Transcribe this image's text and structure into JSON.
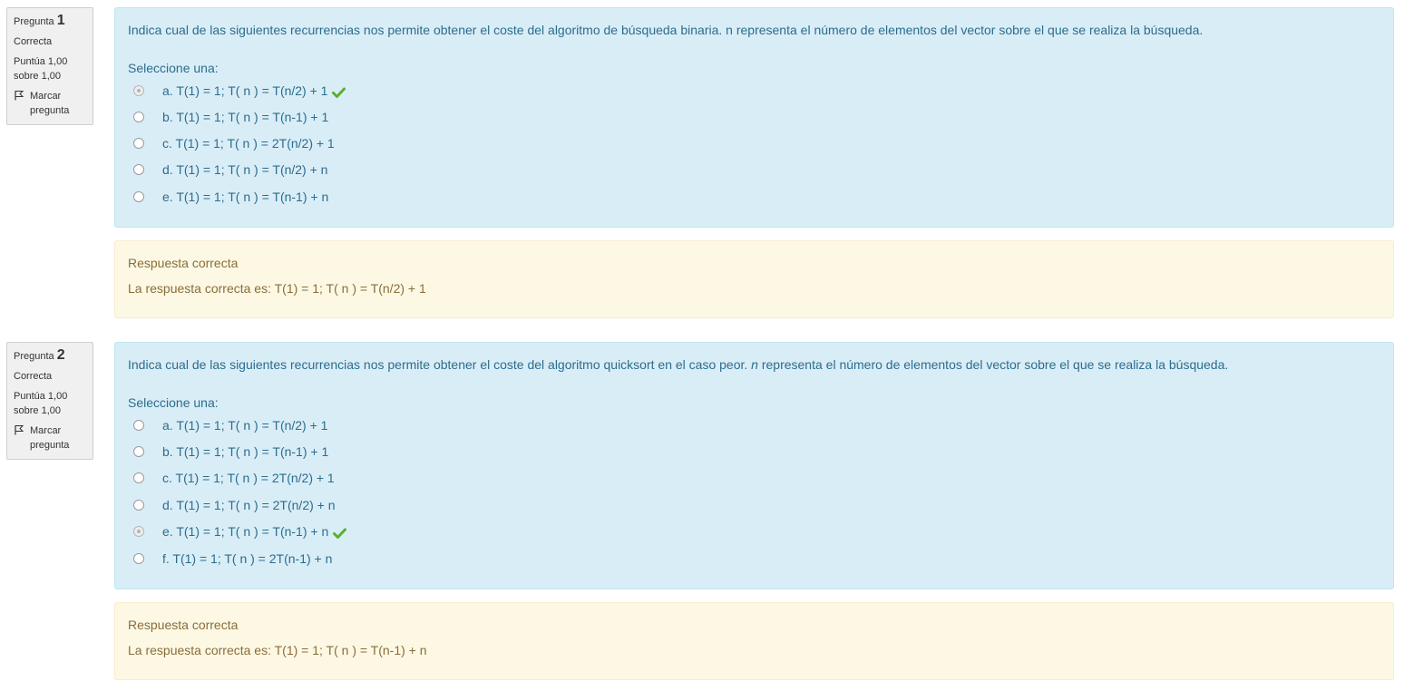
{
  "questions": [
    {
      "label": "Pregunta",
      "number": "1",
      "state": "Correcta",
      "grade": "Puntúa 1,00 sobre 1,00",
      "flag_label": "Marcar pregunta",
      "text": "Indica cual de las siguientes recurrencias nos permite obtener el coste del algoritmo de búsqueda binaria. n representa el número de elementos del vector sobre el que se realiza la búsqueda.",
      "prompt": "Seleccione una:",
      "options": [
        {
          "label": "a. T(1) = 1; T( n ) = T(n/2) + 1",
          "selected": true,
          "correct": true
        },
        {
          "label": "b. T(1) = 1; T( n ) = T(n-1) + 1",
          "selected": false,
          "correct": false
        },
        {
          "label": "c. T(1) = 1; T( n ) = 2T(n/2) + 1",
          "selected": false,
          "correct": false
        },
        {
          "label": "d. T(1) = 1; T( n ) = T(n/2) + n",
          "selected": false,
          "correct": false
        },
        {
          "label": "e. T(1) = 1; T( n ) = T(n-1) + n",
          "selected": false,
          "correct": false
        }
      ],
      "feedback_title": "Respuesta correcta",
      "right_answer": "La respuesta correcta es: T(1) = 1; T( n ) = T(n/2) + 1"
    },
    {
      "label": "Pregunta",
      "number": "2",
      "state": "Correcta",
      "grade": "Puntúa 1,00 sobre 1,00",
      "flag_label": "Marcar pregunta",
      "text_before": "Indica cual de las siguientes recurrencias nos permite obtener el coste del algoritmo quicksort en el caso peor. ",
      "text_em": "n",
      "text_after": " representa el número de elementos del vector sobre el que se realiza la búsqueda.",
      "prompt": "Seleccione una:",
      "options": [
        {
          "label": "a. T(1) = 1; T( n ) = T(n/2) + 1",
          "selected": false,
          "correct": false
        },
        {
          "label": "b. T(1) = 1; T( n ) = T(n-1) + 1",
          "selected": false,
          "correct": false
        },
        {
          "label": "c. T(1) = 1; T( n ) = 2T(n/2) + 1",
          "selected": false,
          "correct": false
        },
        {
          "label": "d. T(1) = 1; T( n ) = 2T(n/2) + n",
          "selected": false,
          "correct": false
        },
        {
          "label": "e. T(1) = 1; T( n ) = T(n-1) + n",
          "selected": true,
          "correct": true
        },
        {
          "label": "f. T(1) = 1; T( n ) = 2T(n-1) + n",
          "selected": false,
          "correct": false
        }
      ],
      "feedback_title": "Respuesta correcta",
      "right_answer": "La respuesta correcta es: T(1) = 1; T( n ) = T(n-1) + n"
    }
  ],
  "colors": {
    "info_bg": "#f0f0f0",
    "question_bg": "#d9edf7",
    "question_text": "#2c6d8c",
    "feedback_bg": "#fcf8e3",
    "feedback_text": "#8a6d3b",
    "check_mark": "#5cb02b"
  },
  "icons": {
    "flag": "flag-icon",
    "correct": "checkmark-icon"
  }
}
